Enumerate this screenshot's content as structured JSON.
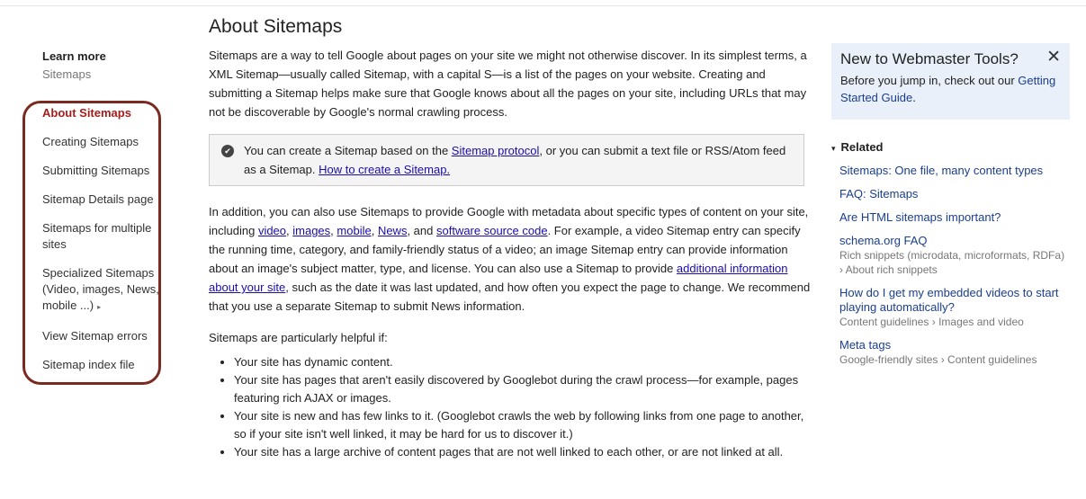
{
  "main": {
    "title": "About Sitemaps",
    "intro": "Sitemaps are a way to tell Google about pages on your site we might not otherwise discover. In its simplest terms, a XML Sitemap—usually called Sitemap, with a capital S—is a list of the pages on your website. Creating and submitting a Sitemap helps make sure that Google knows about all the pages on your site, including URLs that may not be discoverable by Google's normal crawling process.",
    "callout": {
      "text_1": "You can create a Sitemap based on the ",
      "link_protocol": "Sitemap protocol",
      "text_2": ", or you can submit a text file or RSS/Atom feed as a Sitemap. ",
      "link_howto": "How to create a Sitemap."
    },
    "para2": {
      "t1": "In addition, you can also use Sitemaps to provide Google with metadata about specific types of content on your site, including ",
      "l_video": "video",
      "sep1": ", ",
      "l_images": "images",
      "sep2": ", ",
      "l_mobile": "mobile",
      "sep3": ", ",
      "l_news": "News",
      "sep4": ", and ",
      "l_software": "software source code",
      "t2": ". For example, a video Sitemap entry can specify the running time, category, and family-friendly status of a video; an image Sitemap entry can provide information about an image's subject matter, type, and license. You can also use a Sitemap to provide ",
      "l_additional": "additional information about your site",
      "t3": ", such as the date it was last updated, and how often you expect the page to change. We recommend that you use a separate Sitemap to submit News information."
    },
    "helpful_intro": "Sitemaps are particularly helpful if:",
    "bullets": [
      "Your site has dynamic content.",
      "Your site has pages that aren't easily discovered by Googlebot during the crawl process—for example, pages featuring rich AJAX or images.",
      "Your site is new and has few links to it. (Googlebot crawls the web by following links from one page to another, so if your site isn't well linked, it may be hard for us to discover it.)",
      "Your site has a large archive of content pages that are not well linked to each other, or are not linked at all."
    ]
  },
  "sidebar": {
    "learn_more": "Learn more",
    "sub": "Sitemaps",
    "items": [
      {
        "label": "About Sitemaps"
      },
      {
        "label": "Creating Sitemaps"
      },
      {
        "label": "Submitting Sitemaps"
      },
      {
        "label": "Sitemap Details page"
      },
      {
        "label": "Sitemaps for multiple sites"
      },
      {
        "label": "Specialized Sitemaps (Video, images, News, mobile ...)"
      },
      {
        "label": "View Sitemap errors"
      },
      {
        "label": "Sitemap index file"
      }
    ],
    "expand_glyph": "▸",
    "highlight_color": "#7b2a22",
    "active_color": "#a61d1d"
  },
  "right": {
    "new_title": "New to Webmaster Tools?",
    "close_glyph": "✕",
    "new_text_1": "Before you jump in, check out our ",
    "new_link": "Getting Started Guide",
    "new_text_2": ".",
    "related_caret": "▾",
    "related_title": "Related",
    "related": [
      {
        "title": "Sitemaps: One file, many content types",
        "sub": ""
      },
      {
        "title": "FAQ: Sitemaps",
        "sub": ""
      },
      {
        "title": "Are HTML sitemaps important?",
        "sub": ""
      },
      {
        "title": "schema.org FAQ",
        "sub": "Rich snippets (microdata, microformats, RDFa) › About rich snippets"
      },
      {
        "title": "How do I get my embedded videos to start playing automatically?",
        "sub": "Content guidelines › Images and video"
      },
      {
        "title": "Meta tags",
        "sub": "Google-friendly sites › Content guidelines"
      }
    ]
  },
  "icons": {
    "check": "check-circle-icon",
    "close": "close-icon",
    "expand": "triangle-right-icon",
    "related_toggle": "triangle-down-icon"
  }
}
